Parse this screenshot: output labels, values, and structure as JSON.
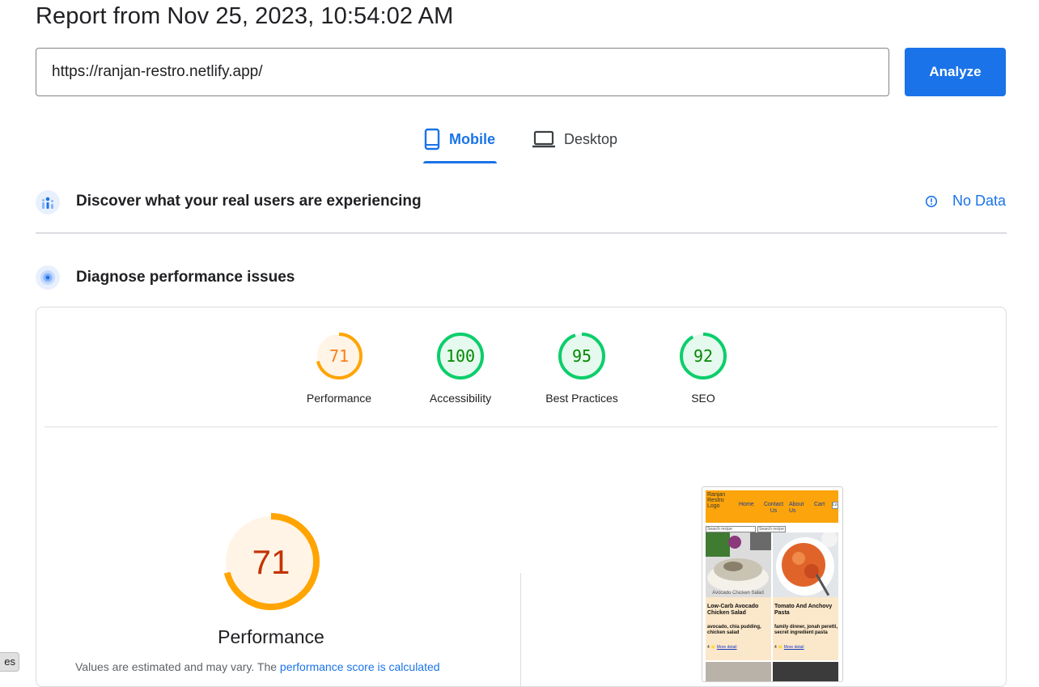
{
  "header": {
    "title": "Report from Nov 25, 2023, 10:54:02 AM"
  },
  "search": {
    "url_value": "https://ranjan-restro.netlify.app/",
    "analyze_label": "Analyze"
  },
  "tabs": [
    {
      "label": "Mobile",
      "icon": "smartphone-icon",
      "active": true
    },
    {
      "label": "Desktop",
      "icon": "laptop-icon",
      "active": false
    }
  ],
  "crux": {
    "title": "Discover what your real users are experiencing",
    "status": "No Data",
    "status_icon": "info-icon"
  },
  "diagnose": {
    "title": "Diagnose performance issues"
  },
  "scores": [
    {
      "label": "Performance",
      "value": 71,
      "color": "#fa7e17",
      "ring_color": "#ffa400",
      "fill": "#fff4e6"
    },
    {
      "label": "Accessibility",
      "value": 100,
      "color": "#008800",
      "ring_color": "#0cce6b",
      "fill": "#e6f9ee"
    },
    {
      "label": "Best Practices",
      "value": 95,
      "color": "#008800",
      "ring_color": "#0cce6b",
      "fill": "#e6f9ee"
    },
    {
      "label": "SEO",
      "value": 92,
      "color": "#008800",
      "ring_color": "#0cce6b",
      "fill": "#e6f9ee"
    }
  ],
  "performance": {
    "score": 71,
    "title": "Performance",
    "note_prefix": "Values are estimated and may vary. The ",
    "note_link": "performance score is calculated"
  },
  "screenshot": {
    "logo_alt": "Ranjan Restro Logo",
    "nav": [
      "Home",
      "Contact Us",
      "About Us",
      "Cart"
    ],
    "login": "Lo",
    "search_placeholder": "Search recipe",
    "search_button": "Search recipe",
    "cards": [
      {
        "title": "Low-Carb Avocado Chicken Salad",
        "caption": "Avocado Chicken Salad",
        "tags": "avocado, chia pudding, chicken salad",
        "rating": "4 ⭐",
        "more": "More detail"
      },
      {
        "title": "Tomato And Anchovy Pasta",
        "tags": "family dinner, jonah peretti, secret ingredient pasta",
        "rating": "4 ⭐",
        "more": "More detail"
      }
    ]
  },
  "footer_chip": "es"
}
